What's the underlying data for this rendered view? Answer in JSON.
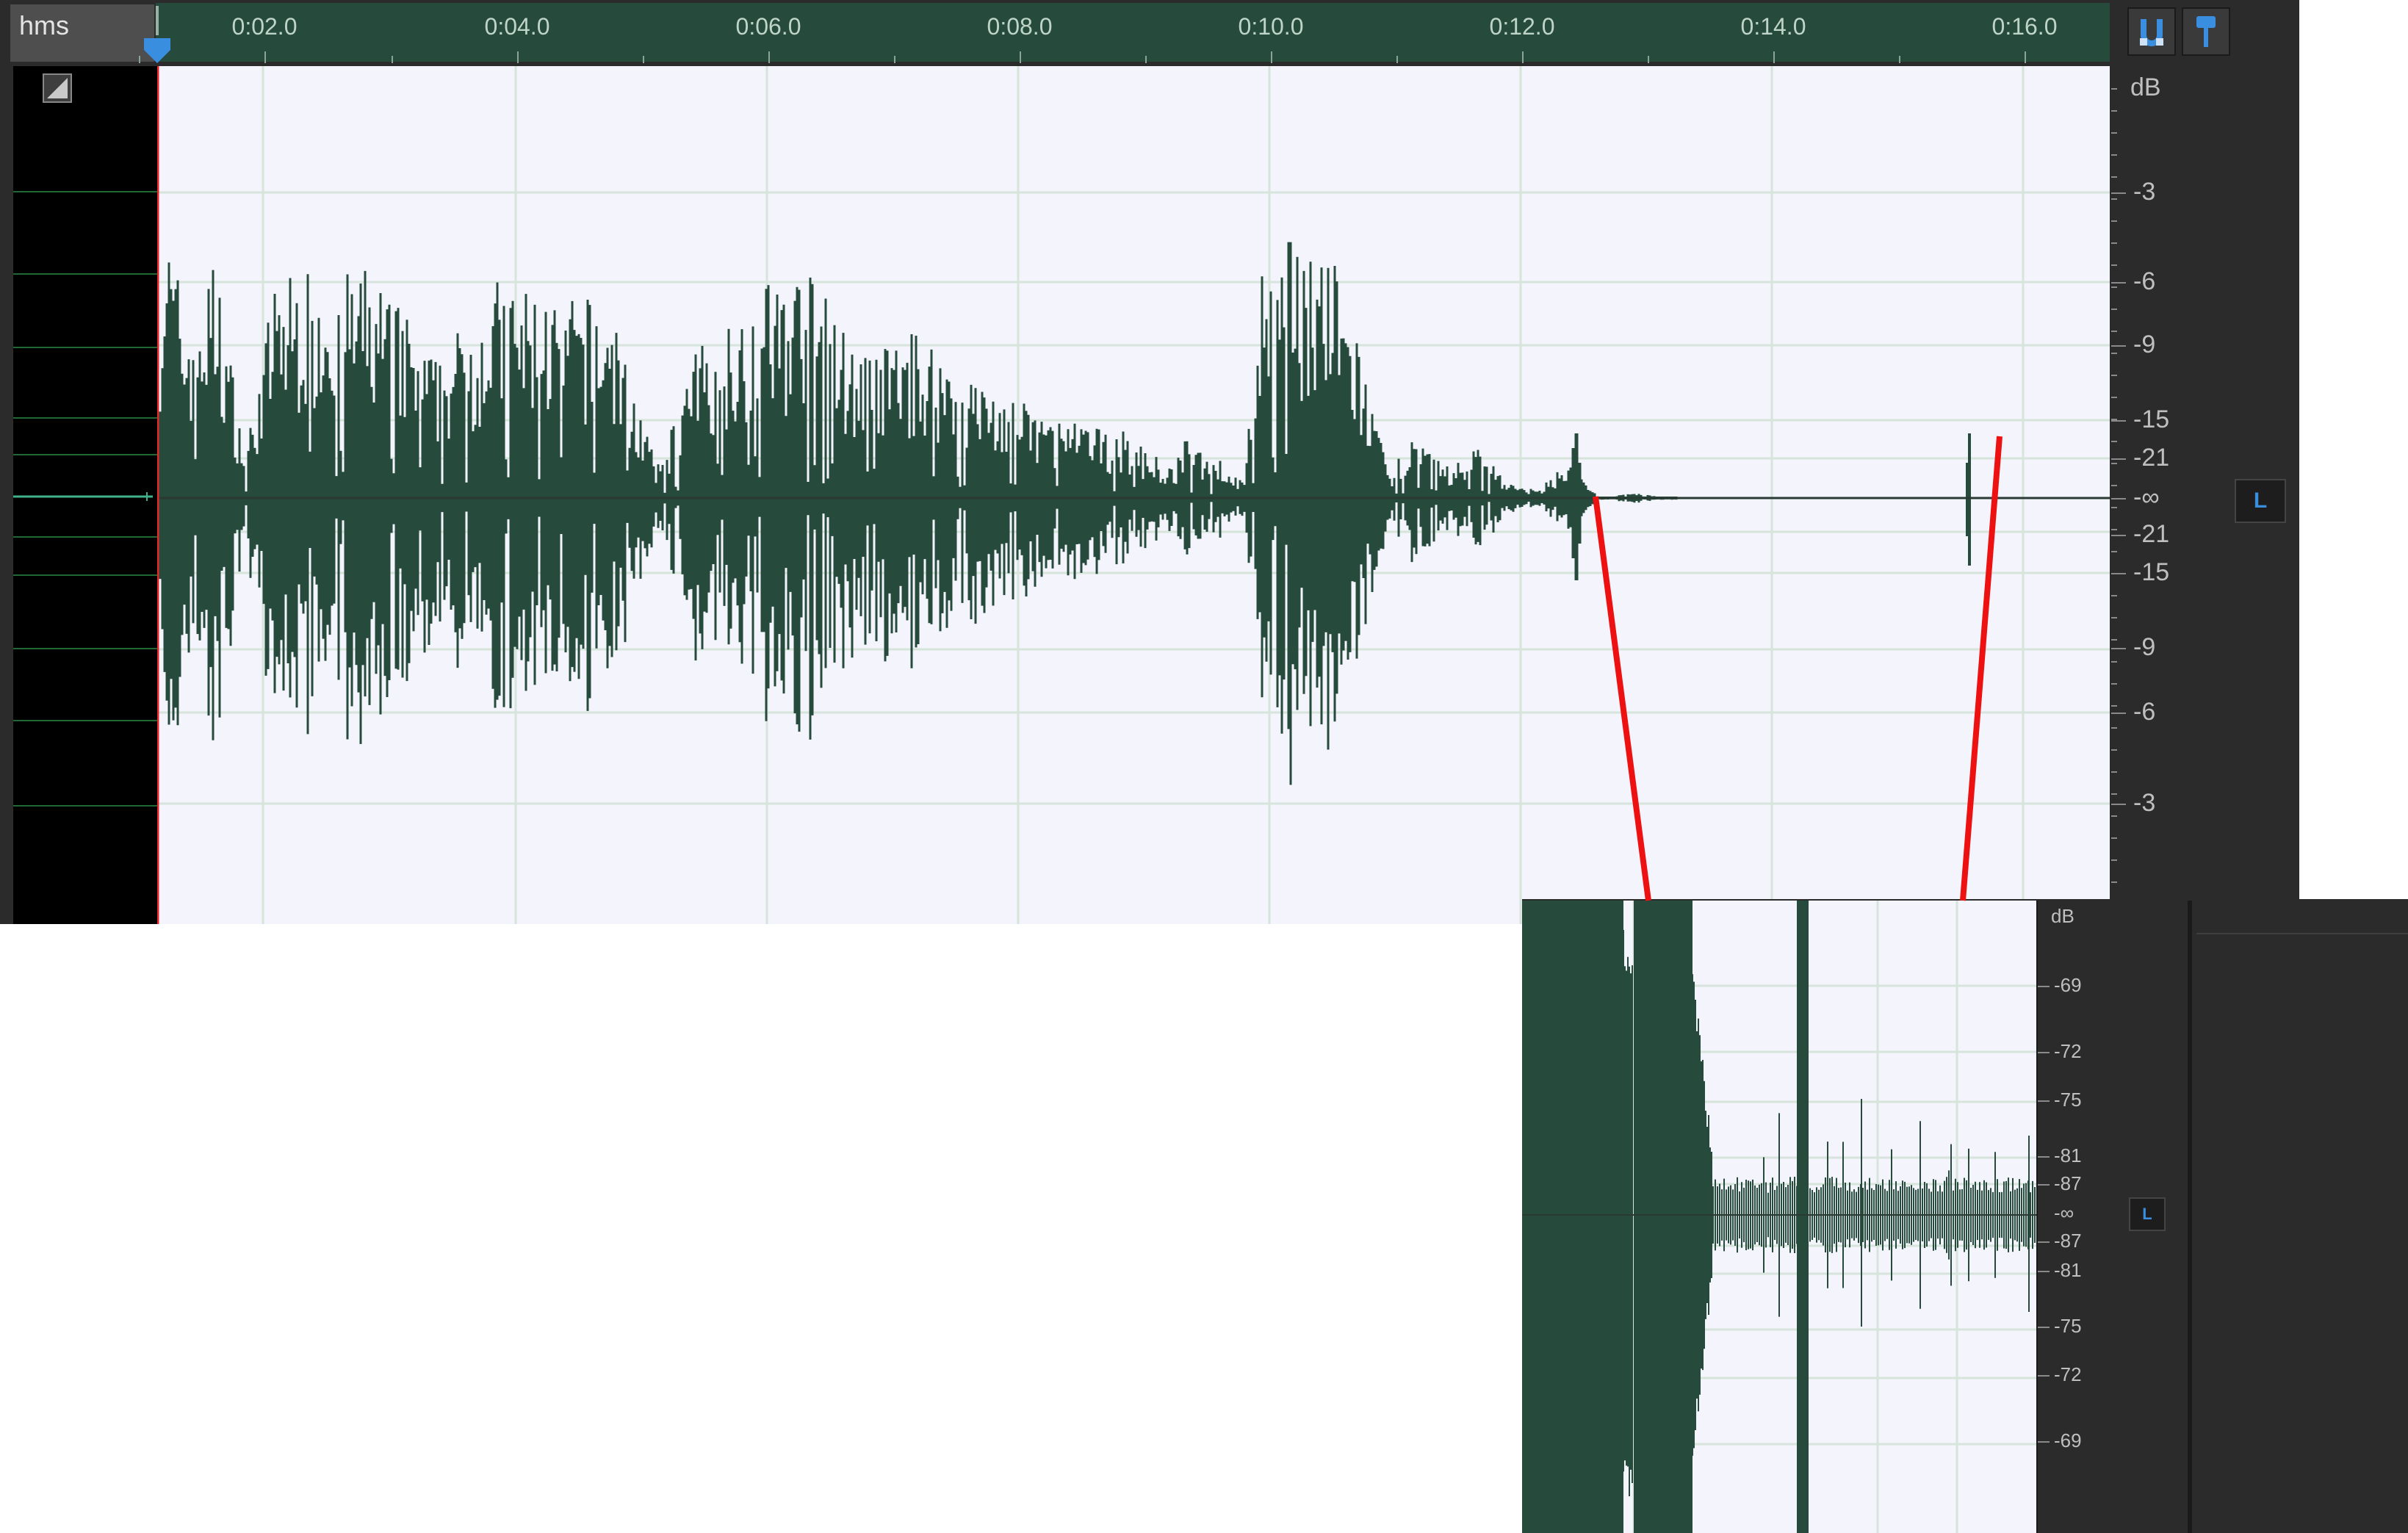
{
  "time_format": "hms",
  "ruler_labels": [
    "0:02.0",
    "0:04.0",
    "0:06.0",
    "0:08.0",
    "0:10.0",
    "0:12.0",
    "0:14.0",
    "0:16.0"
  ],
  "db_unit": "dB",
  "db_top": [
    "-3",
    "-6",
    "-9",
    "-15",
    "-21"
  ],
  "db_center": "-∞",
  "db_bottom": [
    "-21",
    "-15",
    "-9",
    "-6",
    "-3"
  ],
  "channel_label": "L",
  "inset_db_top": [
    "-69",
    "-72",
    "-75",
    "-81",
    "-87"
  ],
  "inset_db_center": "-∞",
  "inset_db_bottom": [
    "-87",
    "-81",
    "-75",
    "-72",
    "-69"
  ],
  "colors": {
    "waveform": "#264a3c",
    "ruler": "#264a3c",
    "canvas": "#f4f5fc",
    "playhead": "#e8252a",
    "callout": "#ee1111",
    "accent": "#3a8ee0"
  },
  "icons": {
    "snap": "magnet-icon",
    "marker": "pin-icon"
  }
}
